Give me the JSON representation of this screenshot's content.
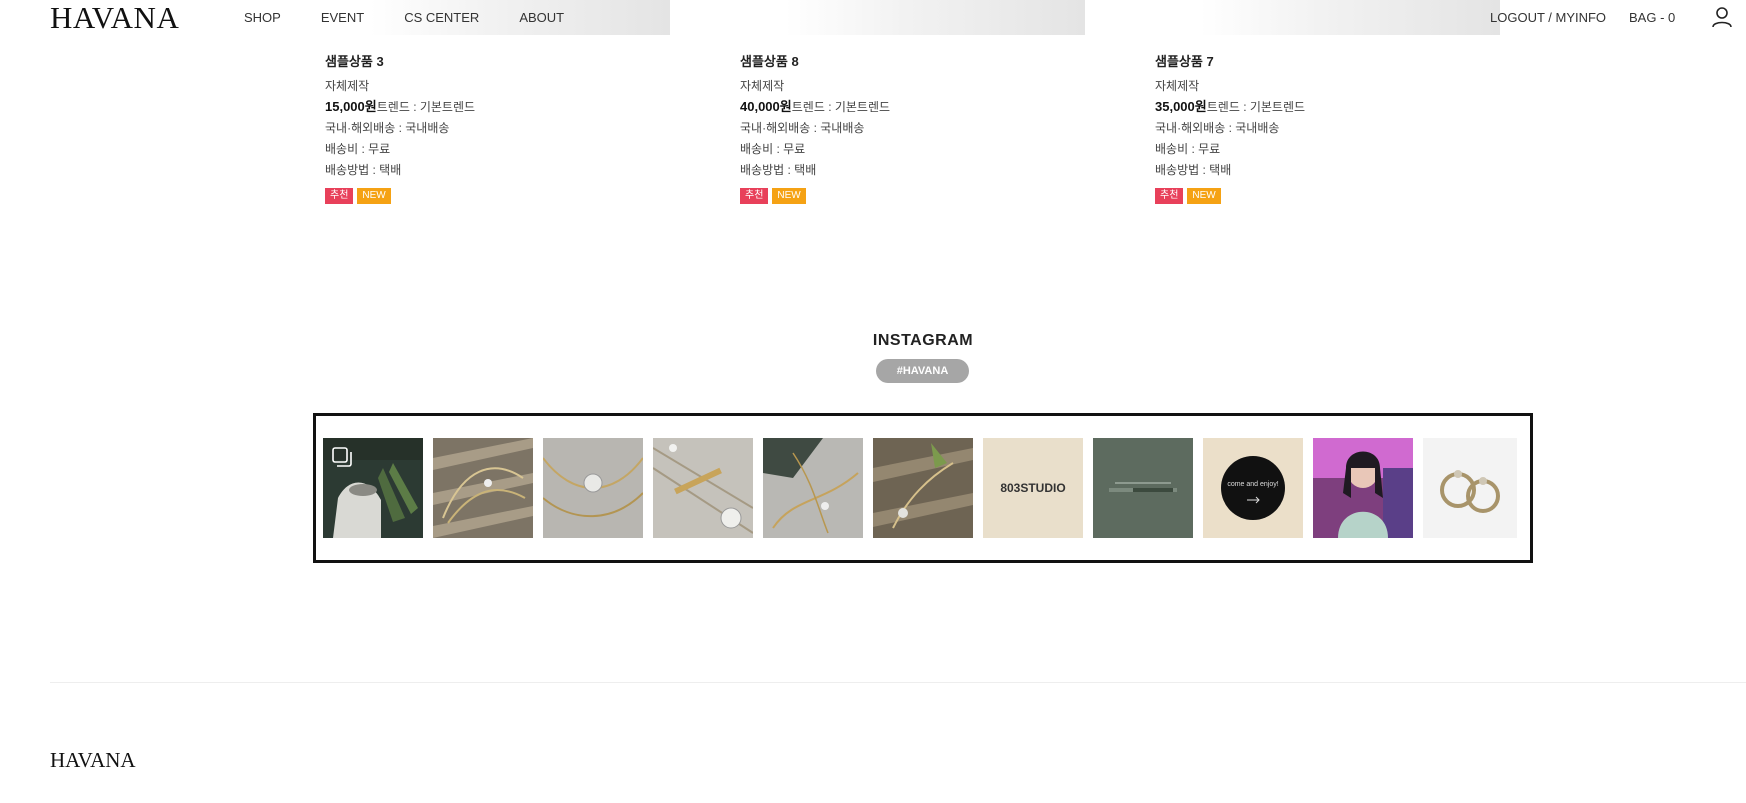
{
  "header": {
    "logo": "HAVANA",
    "nav": [
      "SHOP",
      "EVENT",
      "CS CENTER",
      "ABOUT"
    ],
    "logout_myinfo": "LOGOUT / MYINFO",
    "bag": "BAG - 0",
    "user_icon": "user-icon"
  },
  "products": [
    {
      "name": "샘플상품 3",
      "maker": "자체제작",
      "price": "15,000원",
      "trend": "트렌드 : 기본트렌드",
      "shipping_scope": "국내·해외배송 : 국내배송",
      "shipping_fee": "배송비 : 무료",
      "shipping_method": "배송방법 : 택배",
      "badge_rec": "추천",
      "badge_new": "NEW"
    },
    {
      "name": "샘플상품 8",
      "maker": "자체제작",
      "price": "40,000원",
      "trend": "트렌드 : 기본트렌드",
      "shipping_scope": "국내·해외배송 : 국내배송",
      "shipping_fee": "배송비 : 무료",
      "shipping_method": "배송방법 : 택배",
      "badge_rec": "추천",
      "badge_new": "NEW"
    },
    {
      "name": "샘플상품 7",
      "maker": "자체제작",
      "price": "35,000원",
      "trend": "트렌드 : 기본트렌드",
      "shipping_scope": "국내·해외배송 : 국내배송",
      "shipping_fee": "배송비 : 무료",
      "shipping_method": "배송방법 : 택배",
      "badge_rec": "추천",
      "badge_new": "NEW"
    }
  ],
  "instagram": {
    "title": "INSTAGRAM",
    "tag": "#HAVANA",
    "posts": [
      {
        "icon": "multi-image-icon"
      },
      {},
      {},
      {},
      {},
      {},
      {
        "text": "803STUDIO"
      },
      {},
      {
        "text": "come and enjoy!"
      },
      {},
      {}
    ]
  },
  "footer": {
    "logo": "HAVANA"
  }
}
